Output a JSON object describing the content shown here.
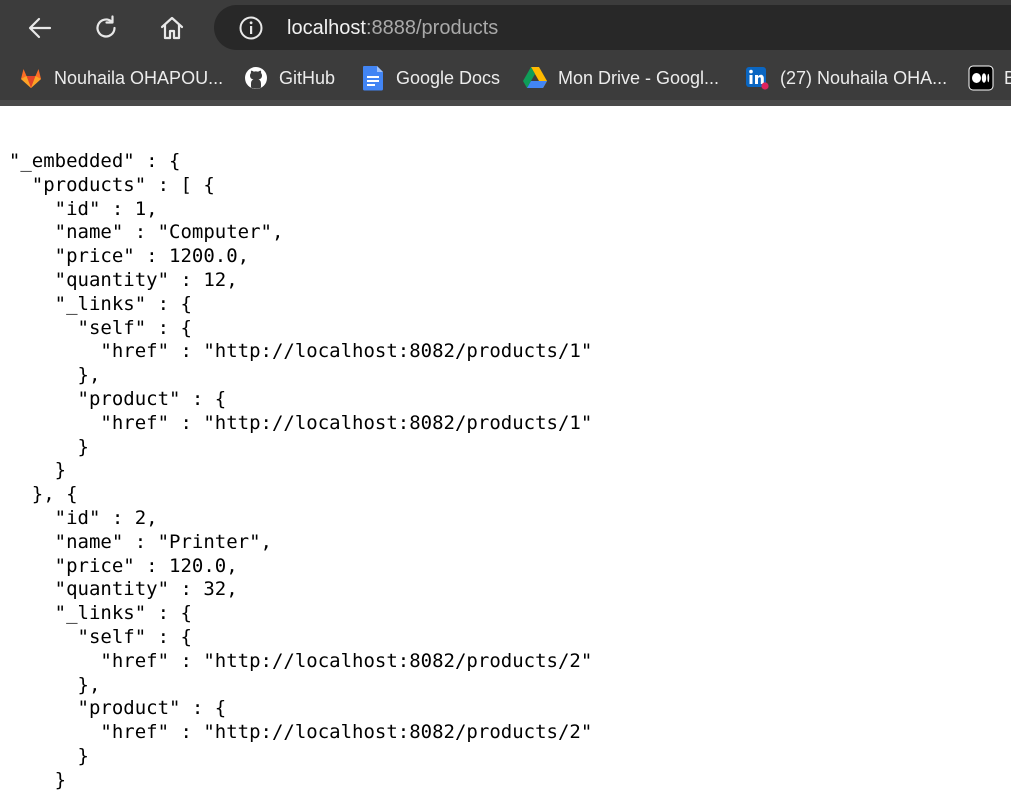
{
  "browser": {
    "nav": {
      "back_icon": "arrow-left-icon",
      "reload_icon": "reload-icon",
      "home_icon": "home-icon"
    },
    "address_bar": {
      "info_icon": "info-icon",
      "url_host": "localhost",
      "url_rest": ":8888/products"
    },
    "bookmarks": [
      {
        "label": "Nouhaila OHAPOU...",
        "icon": "gitlab-icon",
        "color": "#e24329"
      },
      {
        "label": "GitHub",
        "icon": "github-icon",
        "color": "#ffffff"
      },
      {
        "label": "Google Docs",
        "icon": "google-docs-icon",
        "color": "#4285f4"
      },
      {
        "label": "Mon Drive - Googl...",
        "icon": "google-drive-icon",
        "color": "#34a853"
      },
      {
        "label": "(27) Nouhaila OHA...",
        "icon": "linkedin-icon",
        "color": "#0a66c2"
      },
      {
        "label": "B",
        "icon": "medium-icon",
        "color": "#000000"
      }
    ]
  },
  "colors": {
    "toolbar_bg": "#3c3c3c",
    "address_bg": "#282828",
    "page_bg": "#ffffff"
  },
  "json_lines": [
    "  \"_embedded\" : {",
    "    \"products\" : [ {",
    "      \"id\" : 1,",
    "      \"name\" : \"Computer\",",
    "      \"price\" : 1200.0,",
    "      \"quantity\" : 12,",
    "      \"_links\" : {",
    "        \"self\" : {",
    "          \"href\" : \"http://localhost:8082/products/1\"",
    "        },",
    "        \"product\" : {",
    "          \"href\" : \"http://localhost:8082/products/1\"",
    "        }",
    "      }",
    "    }, {",
    "      \"id\" : 2,",
    "      \"name\" : \"Printer\",",
    "      \"price\" : 120.0,",
    "      \"quantity\" : 32,",
    "      \"_links\" : {",
    "        \"self\" : {",
    "          \"href\" : \"http://localhost:8082/products/2\"",
    "        },",
    "        \"product\" : {",
    "          \"href\" : \"http://localhost:8082/products/2\"",
    "        }",
    "      }"
  ]
}
